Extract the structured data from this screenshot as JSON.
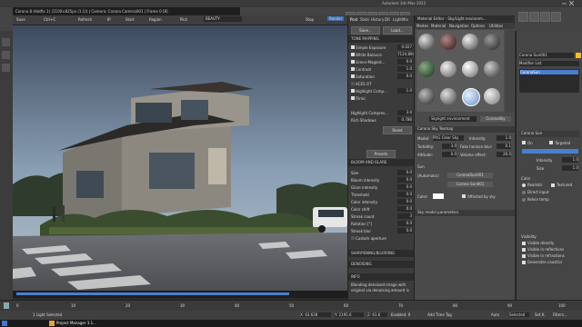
{
  "window": {
    "vfb_title": "Corona 8 (Hotfix 1) (1100×825px (1:1)) | Camera: Corona Camera001 | Frame 0 [8]",
    "app_title": "Autodesk 3ds Max 2022"
  },
  "vfb_toolbar": {
    "save": "Save",
    "ctrl_c": "Ctrl+C",
    "refresh": "Refresh",
    "ip": "IP",
    "start": "Start",
    "region": "Region",
    "pick": "Pick",
    "channel": "BEAUTY",
    "stop": "Stop",
    "render": "Render"
  },
  "settings": {
    "tabs": [
      "Post",
      "Stats",
      "History",
      "DR",
      "LightMix"
    ],
    "save_btn": "Save...",
    "load_btn": "Load...",
    "tone_mapping_header": "TONE MAPPING",
    "rows": [
      {
        "label": "Simple Exposure",
        "value": "0.027",
        "checked": true
      },
      {
        "label": "White Balance",
        "value": "7124.894",
        "checked": true
      },
      {
        "label": "Green-Magent...",
        "value": "0.0",
        "checked": true
      },
      {
        "label": "Contrast",
        "value": "1.0",
        "checked": true
      },
      {
        "label": "Saturation",
        "value": "0.0",
        "checked": true
      },
      {
        "label": "ACES OT",
        "value": "",
        "checked": false
      },
      {
        "label": "Highlight Comp...",
        "value": "1.0",
        "checked": true
      },
      {
        "label": "Filmic",
        "value": "",
        "checked": true
      }
    ],
    "highlight_compress_label": "Highlight Compres...",
    "highlight_compress_value": "3.0",
    "rich_shadows_label": "Rich Shadows",
    "rich_shadows_value": "0.786",
    "reset": "Reset",
    "presets": "Presets",
    "bloom_header": "BLOOM AND GLARE",
    "bloom_rows": [
      {
        "label": "Size",
        "value": "0.0"
      },
      {
        "label": "Bloom intensity",
        "value": "0.0"
      },
      {
        "label": "Glare intensity",
        "value": "0.0"
      },
      {
        "label": "Threshold",
        "value": "0.0"
      },
      {
        "label": "Color intensity",
        "value": "0.0"
      },
      {
        "label": "Color shift",
        "value": "0.0"
      },
      {
        "label": "Streak count",
        "value": "3"
      },
      {
        "label": "Rotation [°]",
        "value": "0.0"
      },
      {
        "label": "Streak blur",
        "value": "0.0"
      },
      {
        "label": "Custom aperture",
        "value": ""
      }
    ],
    "sharpening_header": "SHARPENING/BLURRING",
    "denoising_header": "DENOISING",
    "info_header": "INFO",
    "info_text_1": "Blending denoised image with",
    "info_text_2": "original via denoising amount is"
  },
  "material_editor": {
    "title": "Material Editor - Sky/Light environm...",
    "menus": [
      "Modes",
      "Material",
      "Navigation",
      "Options",
      "Utilities"
    ],
    "current_name": "Skylight environment",
    "type_btn": "CoronaSky",
    "section_header": "Corona Sky Texmap",
    "model_label": "Model:",
    "model_value": "PRG Clear Sky",
    "intensity_label": "Intensity:",
    "intensity_value": "1.0",
    "turbidity_label": "Turbidity:",
    "turbidity_value": "3.0",
    "fake_horizon_label": "Fake horizon blur:",
    "fake_horizon_value": "0.1",
    "altitude_label": "Altitude:",
    "altitude_value": "0.0",
    "volume_effect_label": "Volume effect:",
    "volume_effect_value": "20.0",
    "sun_header": "Sun",
    "sun_label": "(Automatic)",
    "sun_btn": "CoronaSun001",
    "node_label": "Corona Sun001",
    "color_label": "Color:",
    "affected_by_sky": "Affected by sky",
    "bottom_header": "Sky model parameters"
  },
  "cmd_panel": {
    "object_name": "Corona Sun001",
    "modifier_list": "Modifier List",
    "stack_item": "CoronaSun",
    "rollout_header": "Corona Sun",
    "on_label": "On",
    "targeted_label": "Targeted",
    "intensity_label": "Intensity",
    "intensity_value": "1.0",
    "size_label": "Size",
    "size_value": "1.0",
    "color_header": "Color",
    "realistic_label": "Realistic",
    "textured_label": "Textured",
    "direct_input_label": "Direct input",
    "kelvin_label": "Kelvin temp",
    "visibility_header": "Visibility",
    "visible_directly": "Visible directly",
    "visible_reflections": "Visible in reflections",
    "visible_refractions": "Visible in refractions",
    "generates_caustics": "Generates caustics"
  },
  "status": {
    "light_selected": "1 Light Selected",
    "zoom_label": "100%",
    "x_value": "X: 63.628",
    "y_value": "Y: 2195.6",
    "z_value": "Z: 61.6",
    "enabled": "Enabled: 0",
    "add_time_tag": "Add Time Tag",
    "auto": "Auto",
    "selected": "Selected",
    "set_key": "Set K.",
    "filters": "Filters..."
  },
  "taskbar": {
    "project_manager": "Project Manager 3.1..."
  },
  "timeline": {
    "ticks": [
      "0",
      "10",
      "20",
      "30",
      "40",
      "50",
      "60",
      "70",
      "80",
      "90",
      "100"
    ]
  },
  "colors": {
    "accent_blue": "#4a7fd0",
    "panel": "#3b3b3b",
    "dark": "#1e1e1e"
  }
}
